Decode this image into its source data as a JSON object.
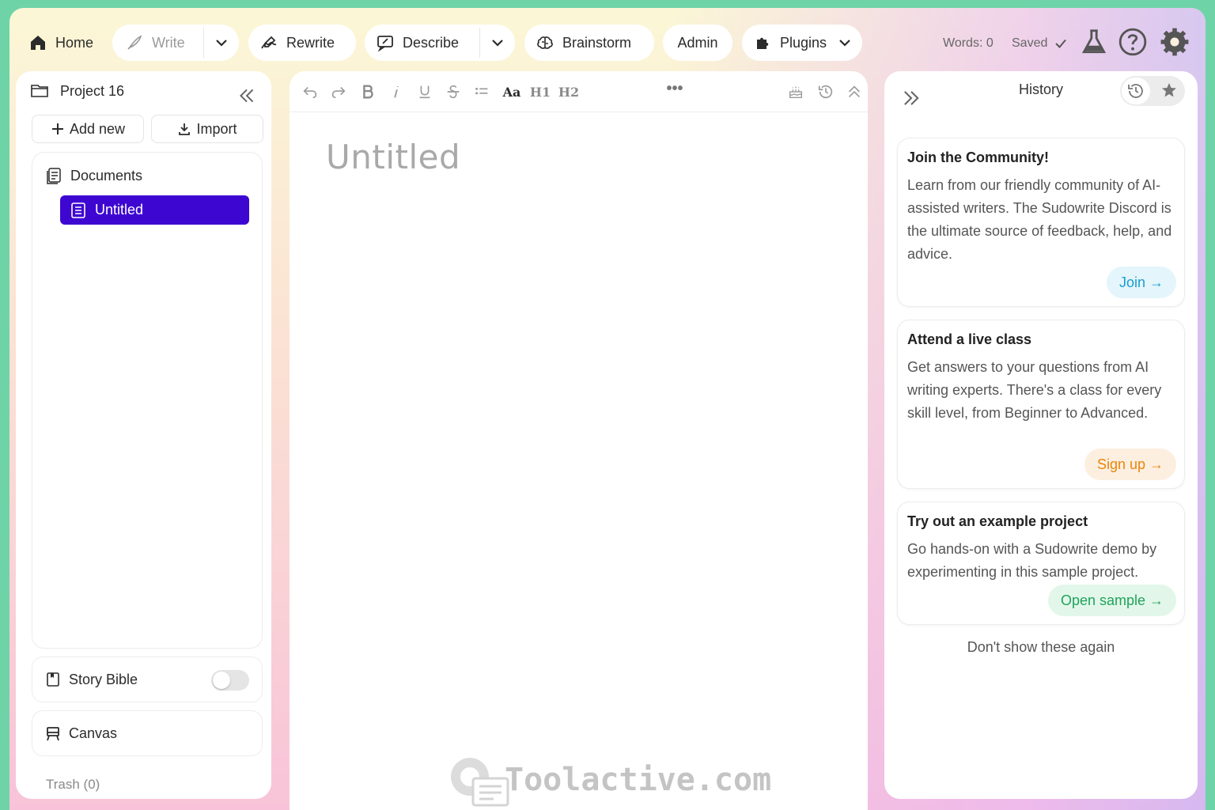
{
  "topbar": {
    "home_label": "Home",
    "write_label": "Write",
    "rewrite_label": "Rewrite",
    "describe_label": "Describe",
    "brainstorm_label": "Brainstorm",
    "admin_label": "Admin",
    "plugins_label": "Plugins",
    "words_label": "Words: 0",
    "saved_label": "Saved"
  },
  "sidebar": {
    "project_name": "Project 16",
    "add_new_label": "Add new",
    "import_label": "Import",
    "documents_label": "Documents",
    "documents": [
      {
        "label": "Untitled",
        "selected": true
      }
    ],
    "story_bible_label": "Story Bible",
    "story_bible_enabled": false,
    "canvas_label": "Canvas",
    "trash_label": "Trash (0)"
  },
  "editor": {
    "toolbar": {
      "font_size_label": "Aa",
      "h1_label": "H1",
      "h2_label": "H2",
      "more_label": "•••"
    },
    "document_title": "Untitled",
    "watermark_text": "Toolactive.com"
  },
  "history_panel": {
    "title": "History",
    "cards": [
      {
        "title": "Join the Community!",
        "body": "Learn from our friendly community of AI-assisted writers. The Sudowrite Discord is the ultimate source of feedback, help, and advice.",
        "cta": "Join →",
        "cta_color": "#1a9dd1"
      },
      {
        "title": "Attend a live class",
        "body": "Get answers to your questions from AI writing experts. There's a class for every skill level, from Beginner to Advanced.",
        "cta": "Sign up →",
        "cta_color": "#e8860c"
      },
      {
        "title": "Try out an example project",
        "body": "Go hands-on with a Sudowrite demo by experimenting in this sample project.",
        "cta": "Open sample →",
        "cta_color": "#21a35c"
      }
    ],
    "dont_show_label": "Don't show these again"
  },
  "colors": {
    "accent": "#3e07d1",
    "window_border": "#6fd3a8"
  }
}
